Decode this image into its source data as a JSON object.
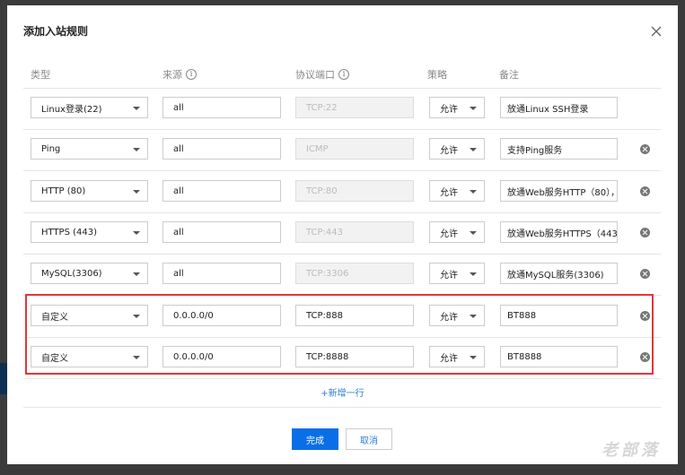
{
  "dialog": {
    "title": "添加入站规则",
    "columns": {
      "type": "类型",
      "source": "来源",
      "port": "协议端口",
      "policy": "策略",
      "remark": "备注"
    },
    "rows": [
      {
        "type": "Linux登录(22)",
        "source": "all",
        "port": "TCP:22",
        "port_disabled": true,
        "policy": "允许",
        "remark": "放通Linux SSH登录",
        "deletable": false
      },
      {
        "type": "Ping",
        "source": "all",
        "port": "ICMP",
        "port_disabled": true,
        "policy": "允许",
        "remark": "支持Ping服务",
        "deletable": true
      },
      {
        "type": "HTTP (80)",
        "source": "all",
        "port": "TCP:80",
        "port_disabled": true,
        "policy": "允许",
        "remark": "放通Web服务HTTP（80），",
        "deletable": true
      },
      {
        "type": "HTTPS (443)",
        "source": "all",
        "port": "TCP:443",
        "port_disabled": true,
        "policy": "允许",
        "remark": "放通Web服务HTTPS（443",
        "deletable": true
      },
      {
        "type": "MySQL(3306)",
        "source": "all",
        "port": "TCP:3306",
        "port_disabled": true,
        "policy": "允许",
        "remark": "放通MySQL服务(3306)",
        "deletable": true
      },
      {
        "type": "自定义",
        "source": "0.0.0.0/0",
        "port": "TCP:888",
        "port_disabled": false,
        "policy": "允许",
        "remark": "BT888",
        "deletable": true
      },
      {
        "type": "自定义",
        "source": "0.0.0.0/0",
        "port": "TCP:8888",
        "port_disabled": false,
        "policy": "允许",
        "remark": "BT8888",
        "deletable": true
      }
    ],
    "add_row_label": "+新增一行",
    "confirm_label": "完成",
    "cancel_label": "取消"
  },
  "watermark": "老部落",
  "colors": {
    "primary": "#0a6fe6",
    "link": "#2d7bde",
    "highlight_border": "#e8333a"
  }
}
